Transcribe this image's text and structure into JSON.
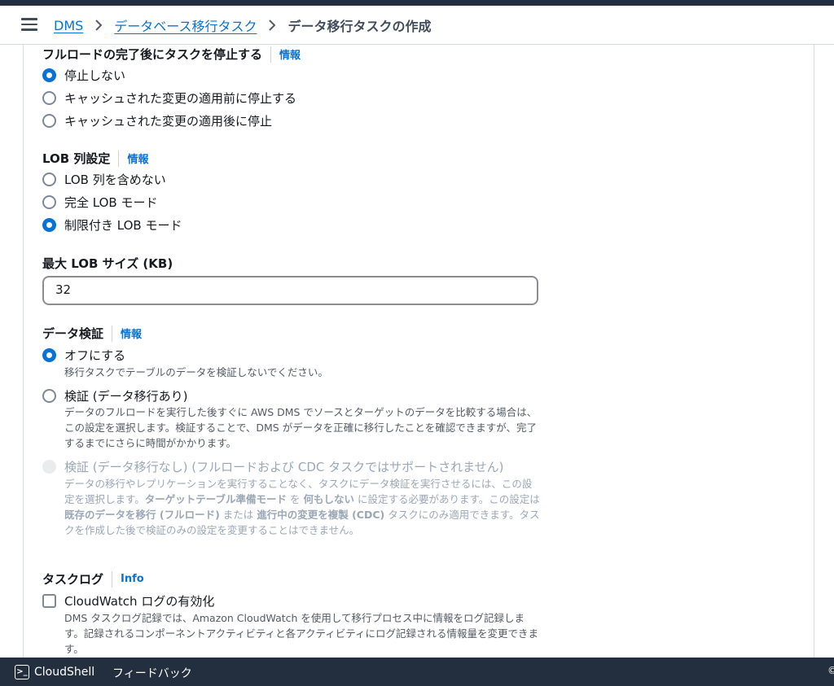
{
  "breadcrumb": {
    "items": [
      "DMS",
      "データベース移行タスク"
    ],
    "current": "データ移行タスクの作成"
  },
  "stop_after_full_load": {
    "label": "フルロードの完了後にタスクを停止する",
    "info": "情報",
    "options": [
      "停止しない",
      "キャッシュされた変更の適用前に停止する",
      "キャッシュされた変更の適用後に停止"
    ],
    "selected": "停止しない"
  },
  "lob_settings": {
    "label": "LOB 列設定",
    "info": "情報",
    "options": [
      "LOB 列を含めない",
      "完全 LOB モード",
      "制限付き LOB モード"
    ],
    "selected": "制限付き LOB モード"
  },
  "max_lob_size": {
    "label": "最大 LOB サイズ (KB)",
    "value": "32"
  },
  "data_validation": {
    "label": "データ検証",
    "info": "情報",
    "options": [
      {
        "label": "オフにする",
        "description": "移行タスクでテーブルのデータを検証しないでください。"
      },
      {
        "label": "検証 (データ移行あり)",
        "description": "データのフルロードを実行した後すぐに AWS DMS でソースとターゲットのデータを比較する場合は、この設定を選択します。検証することで、DMS がデータを正確に移行したことを確認できますが、完了するまでにさらに時間がかかります。"
      },
      {
        "label": "検証 (データ移行なし) (フルロードおよび CDC タスクではサポートされません)",
        "desc_parts": [
          "データの移行やレプリケーションを実行することなく、タスクにデータ検証を実行させるには、この設定を選択します。",
          "ターゲットテーブル準備モード",
          " を ",
          "何もしない",
          " に設定する必要があります。この設定は ",
          "既存のデータを移行 (フルロード)",
          " または ",
          "進行中の変更を複製 (CDC)",
          " タスクにのみ適用できます。タスクを作成した後で検証のみの設定を変更することはできません。"
        ]
      }
    ],
    "selected": "オフにする"
  },
  "task_log": {
    "label": "タスクログ",
    "info": "Info",
    "checkbox_label": "CloudWatch ログの有効化",
    "description": "DMS タスクログ記録では、Amazon CloudWatch を使用して移行プロセス中に情報をログ記録します。記録されるコンポーネントアクティビティと各アクティビティにログ記録される情報量を変更できます。",
    "checked": false
  },
  "footer": {
    "cloudshell": "CloudShell",
    "feedback": "フィードバック",
    "copyright": "©"
  },
  "colors": {
    "link": "#0972d3",
    "footer_bg": "#232f3e",
    "disabled_text": "#9ba7b6"
  }
}
